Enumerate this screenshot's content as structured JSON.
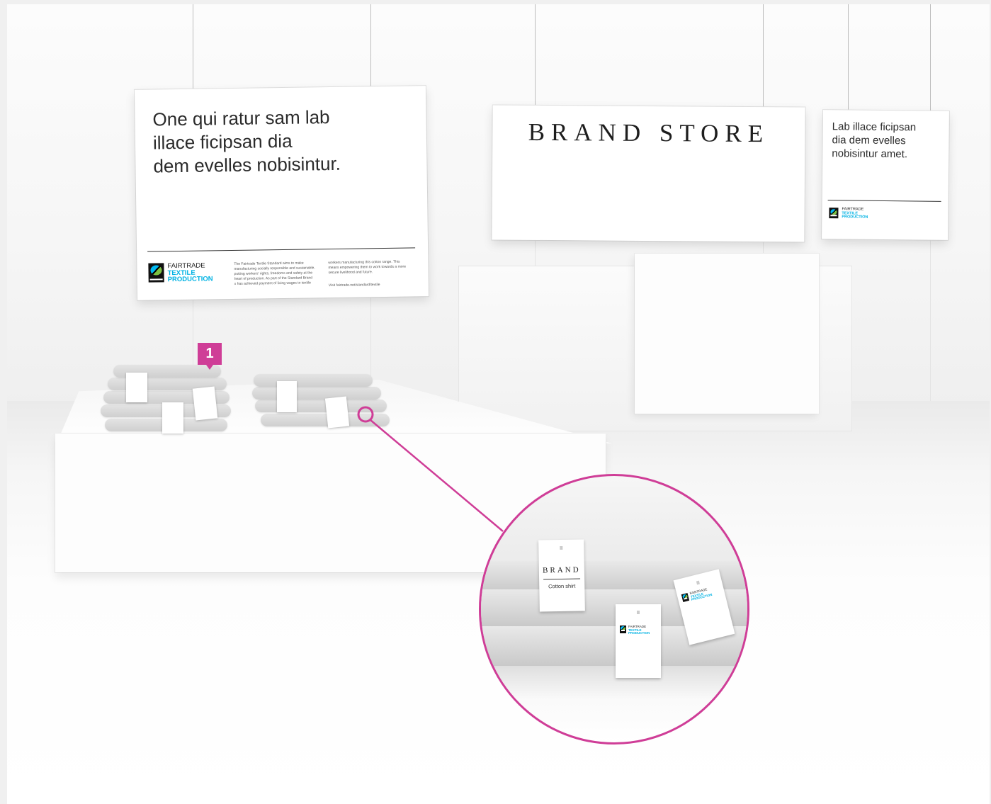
{
  "sign_left": {
    "headline": "One qui ratur sam lab\nillace ficipsan dia\ndem evelles nobisintur.",
    "logo": {
      "line1": "FAIRTRADE",
      "line2": "TEXTILE",
      "line3": "PRODUCTION",
      "mark_text": "FAIRTRADE"
    },
    "copy_col1": "The Fairtrade Textile Standard aims to make\nmanufacturing socially responsible and sustainable,\nputting workers' rights, freedoms and safety at the\nheart of production. As part of the Standard Brand\nx has achieved payment of living wages to textile",
    "copy_col2": "workers manufacturing this cotton range. This\nmeans empowering them to work towards a more\nsecure livelihood and future.",
    "copy_link": "Visit fairtrade.net/standard/textile"
  },
  "sign_center": {
    "brand": "BRAND STORE"
  },
  "sign_right": {
    "headline": "Lab illace ficipsan\ndia dem evelles\nnobisintur amet.",
    "logo": {
      "line1": "FAIRTRADE",
      "line2": "TEXTILE",
      "line3": "PRODUCTION"
    }
  },
  "marker": {
    "number": "1",
    "color": "#cf3d97"
  },
  "zoom": {
    "brand_tag": {
      "brand": "BRAND",
      "label": "Cotton shirt"
    },
    "ft_tag": {
      "line1": "FAIRTRADE",
      "line2": "TEXTILE",
      "line3": "PRODUCTION"
    }
  },
  "colors": {
    "accent": "#cf3d97",
    "fairtrade_blue": "#00b2e3"
  }
}
